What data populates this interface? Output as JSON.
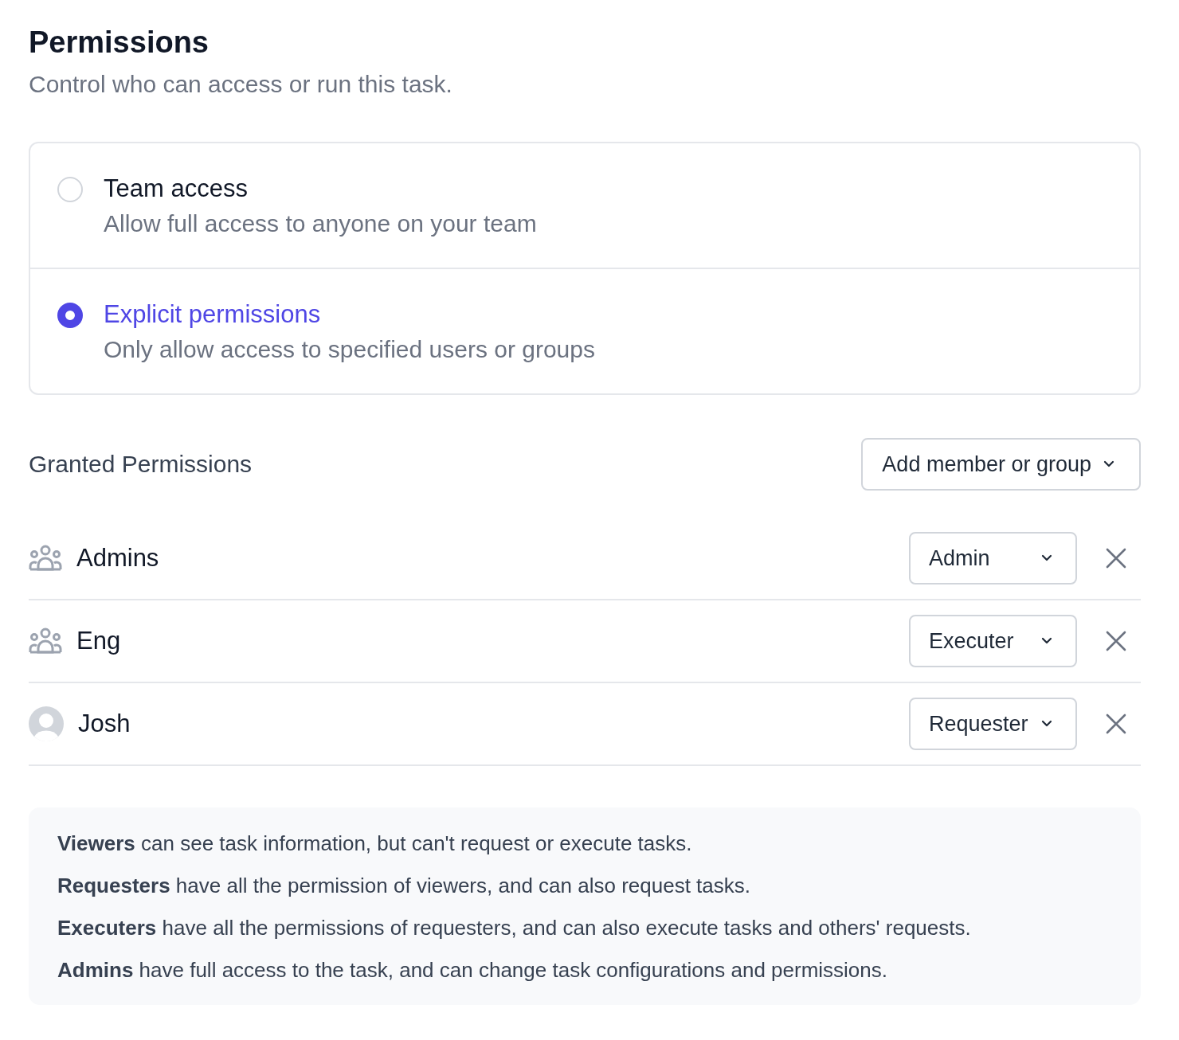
{
  "header": {
    "title": "Permissions",
    "subtitle": "Control who can access or run this task."
  },
  "access_options": [
    {
      "label": "Team access",
      "description": "Allow full access to anyone on your team",
      "selected": false
    },
    {
      "label": "Explicit permissions",
      "description": "Only allow access to specified users or groups",
      "selected": true
    }
  ],
  "granted": {
    "title": "Granted Permissions",
    "add_button": "Add member or group",
    "members": [
      {
        "kind": "group",
        "name": "Admins",
        "role": "Admin"
      },
      {
        "kind": "group",
        "name": "Eng",
        "role": "Executer"
      },
      {
        "kind": "user",
        "name": "Josh",
        "role": "Requester"
      }
    ]
  },
  "notes": [
    "**Viewers** can see task information, but can't request or execute tasks.",
    "**Requesters** have all the permission of viewers, and can also request tasks.",
    "**Executers** have all the permissions of requesters, and can also execute tasks and others' requests.",
    "**Admins** have full access to the task, and can change task configurations and permissions."
  ]
}
